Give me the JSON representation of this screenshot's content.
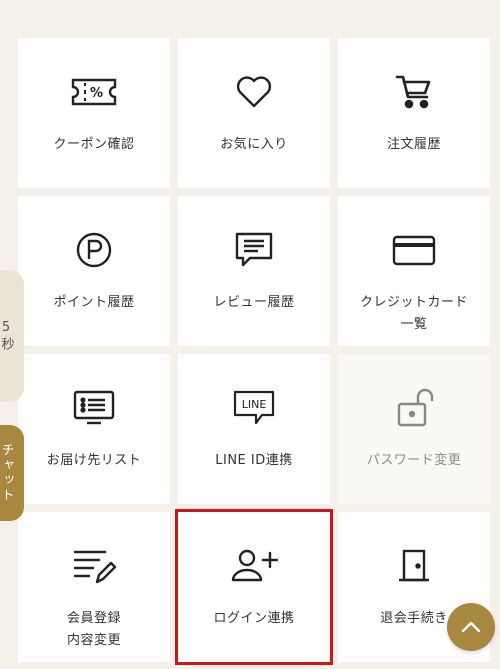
{
  "menu": {
    "items": [
      {
        "label": "クーポン確認",
        "icon": "coupon-icon"
      },
      {
        "label": "お気に入り",
        "icon": "heart-icon"
      },
      {
        "label": "注文履歴",
        "icon": "cart-icon"
      },
      {
        "label": "ポイント履歴",
        "icon": "point-icon"
      },
      {
        "label": "レビュー履歴",
        "icon": "review-icon"
      },
      {
        "label": "クレジットカード\n一覧",
        "icon": "credit-card-icon"
      },
      {
        "label": "お届け先リスト",
        "icon": "address-list-icon"
      },
      {
        "label": "LINE ID連携",
        "icon": "line-icon"
      },
      {
        "label": "パスワード変更",
        "icon": "unlock-icon"
      },
      {
        "label": "会員登録\n内容変更",
        "icon": "edit-list-icon"
      },
      {
        "label": "ログイン連携",
        "icon": "add-user-icon"
      },
      {
        "label": "退会手続き",
        "icon": "door-icon"
      }
    ]
  },
  "side_tabs": {
    "timer": "5秒",
    "chat": "チャット"
  },
  "icons": {
    "line_text": "LINE"
  },
  "colors": {
    "accent": "#a8873e",
    "highlight": "#d0141c",
    "background": "#f5f1ea"
  }
}
